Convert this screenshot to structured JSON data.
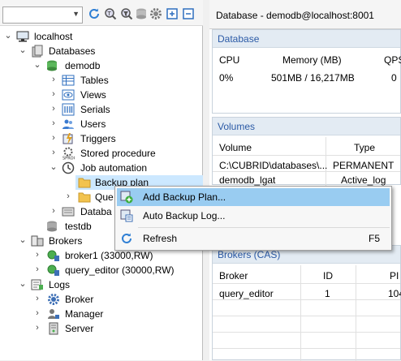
{
  "toolbar": {
    "combo_value": ""
  },
  "tree": {
    "localhost": "localhost",
    "databases": "Databases",
    "demodb": "demodb",
    "tables": "Tables",
    "views": "Views",
    "serials": "Serials",
    "users": "Users",
    "triggers": "Triggers",
    "stored_procedure": "Stored procedure",
    "job_automation": "Job automation",
    "backup_plan": "Backup plan",
    "query_plan_partial": "Que",
    "database_partial": "Databa",
    "testdb": "testdb",
    "brokers": "Brokers",
    "broker1": "broker1 (33000,RW)",
    "query_editor": "query_editor (30000,RW)",
    "logs": "Logs",
    "broker": "Broker",
    "manager": "Manager",
    "server": "Server"
  },
  "right": {
    "title": "Database - demodb@localhost:8001",
    "database_panel": {
      "header": "Database",
      "columns": [
        "CPU",
        "Memory (MB)",
        "QPS"
      ],
      "row": [
        "0%",
        "501MB / 16,217MB",
        "0"
      ]
    },
    "volumes_panel": {
      "header": "Volumes",
      "columns": [
        "Volume",
        "Type"
      ],
      "rows": [
        [
          "C:\\CUBRID\\databases\\...",
          "PERMANENT"
        ],
        [
          "demodb_lgat",
          "Active_log"
        ]
      ]
    },
    "brokers_panel": {
      "header": "Brokers (CAS)",
      "columns": [
        "Broker",
        "ID",
        "PI"
      ],
      "row": [
        "query_editor",
        "1",
        "104"
      ]
    }
  },
  "context_menu": {
    "items": [
      {
        "label": "Add Backup Plan...",
        "shortcut": ""
      },
      {
        "label": "Auto Backup Log...",
        "shortcut": ""
      },
      {
        "label": "Refresh",
        "shortcut": "F5"
      }
    ]
  },
  "colors": {
    "selection": "#cce8ff",
    "menu_highlight": "#99ccf1",
    "panel_header": "#e3ebf3",
    "panel_header_text": "#2b5aa6"
  }
}
